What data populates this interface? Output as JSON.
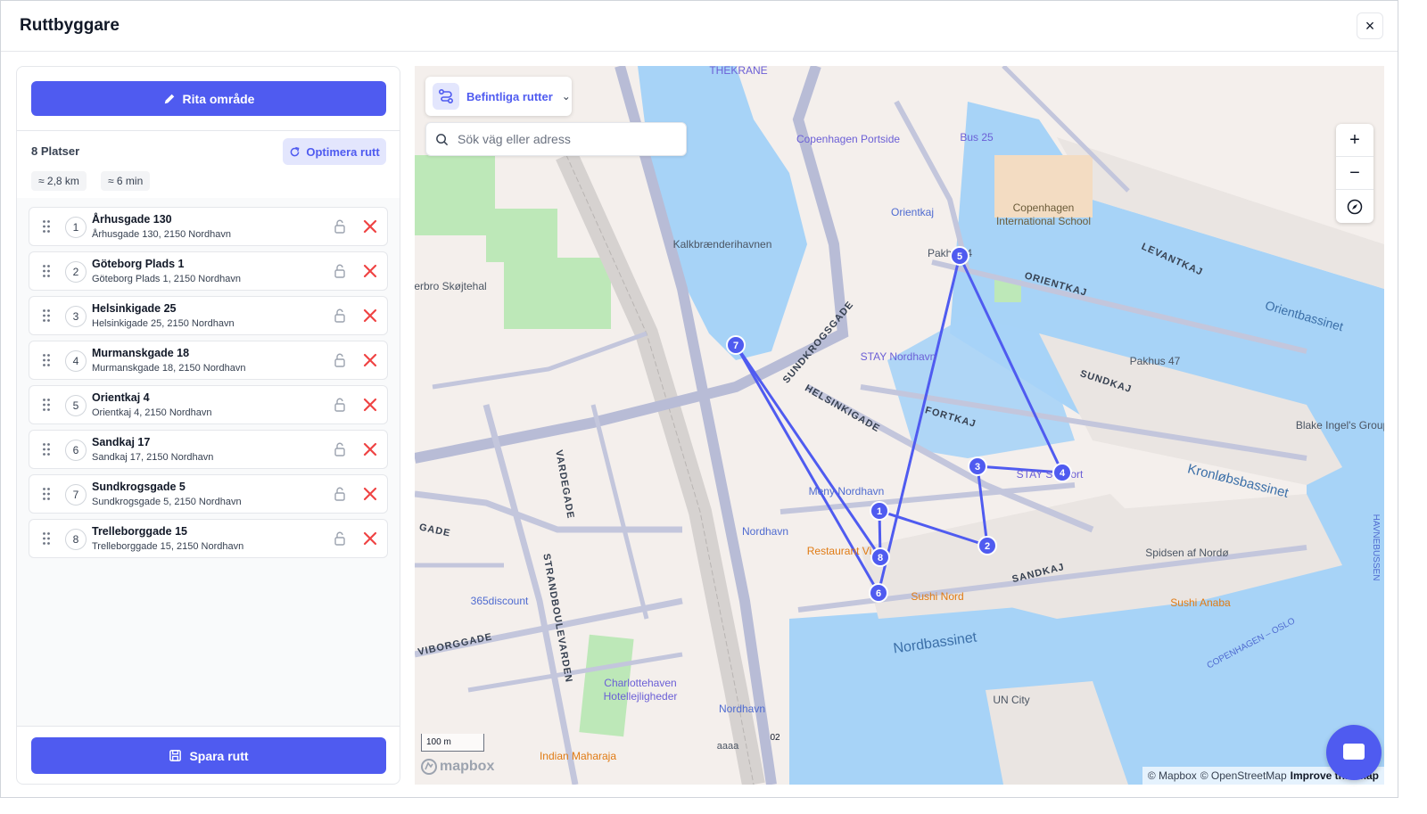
{
  "header": {
    "title": "Ruttbyggare",
    "close_label": "×"
  },
  "panel": {
    "draw_label": "Rita område",
    "places_count": "8 Platser",
    "optimize_label": "Optimera rutt",
    "distance": "≈ 2,8 km",
    "duration": "≈ 6 min",
    "save_label": "Spara rutt",
    "stops": [
      {
        "n": "1",
        "name": "Århusgade 130",
        "addr": "Århusgade 130, 2150 Nordhavn"
      },
      {
        "n": "2",
        "name": "Göteborg Plads 1",
        "addr": "Göteborg Plads 1, 2150 Nordhavn"
      },
      {
        "n": "3",
        "name": "Helsinkigade 25",
        "addr": "Helsinkigade 25, 2150 Nordhavn"
      },
      {
        "n": "4",
        "name": "Murmanskgade 18",
        "addr": "Murmanskgade 18, 2150 Nordhavn"
      },
      {
        "n": "5",
        "name": "Orientkaj 4",
        "addr": "Orientkaj 4, 2150 Nordhavn"
      },
      {
        "n": "6",
        "name": "Sandkaj 17",
        "addr": "Sandkaj 17, 2150 Nordhavn"
      },
      {
        "n": "7",
        "name": "Sundkrogsgade 5",
        "addr": "Sundkrogsgade 5, 2150 Nordhavn"
      },
      {
        "n": "8",
        "name": "Trelleborggade 15",
        "addr": "Trelleborggade 15, 2150 Nordhavn"
      }
    ]
  },
  "map": {
    "routes_label": "Befintliga rutter",
    "search_placeholder": "Sök väg eller adress",
    "zoom_in": "+",
    "zoom_out": "−",
    "scale_label": "100 m",
    "logo_text": "mapbox",
    "attribution": {
      "mapbox": "© Mapbox",
      "osm": "© OpenStreetMap",
      "improve": "Improve this map"
    },
    "route_color": "#4f5bf0",
    "water_color": "#a7d3f7",
    "park_color": "#bde8b8",
    "labels": [
      {
        "text": "THEKRANE",
        "kind": "poi"
      },
      {
        "text": "Copenhagen Portside",
        "kind": "poi"
      },
      {
        "text": "Bus 25",
        "kind": "poi"
      },
      {
        "text": "Copenhagen",
        "kind": "school"
      },
      {
        "text": "International School",
        "kind": "school"
      },
      {
        "text": "Orientkaj",
        "kind": "transit"
      },
      {
        "text": "Kalkbrænderihavnen",
        "kind": "place"
      },
      {
        "text": "Pakhus 4",
        "kind": "place"
      },
      {
        "text": "LEVANTKAJ",
        "kind": "street"
      },
      {
        "text": "ORIENTKAJ",
        "kind": "street"
      },
      {
        "text": "Orientbassinet",
        "kind": "water"
      },
      {
        "text": "erbro Skøjtehal",
        "kind": "poi"
      },
      {
        "text": "SUNDKROGSGADE",
        "kind": "street"
      },
      {
        "text": "STAY Nordhavn",
        "kind": "poi"
      },
      {
        "text": "Pakhus 47",
        "kind": "place"
      },
      {
        "text": "SUNDKAJ",
        "kind": "street"
      },
      {
        "text": "HELSINKIGADE",
        "kind": "street"
      },
      {
        "text": "FORTKAJ",
        "kind": "street"
      },
      {
        "text": "Blake Ingel's Group",
        "kind": "place"
      },
      {
        "text": "VARDEGADE",
        "kind": "street"
      },
      {
        "text": "Meny Nordhavn",
        "kind": "poi"
      },
      {
        "text": "STAY Seaport",
        "kind": "poi"
      },
      {
        "text": "Kronløbsbassinet",
        "kind": "water"
      },
      {
        "text": "GADE",
        "kind": "street"
      },
      {
        "text": "Nordhavn",
        "kind": "transit"
      },
      {
        "text": "Restaurant Vi",
        "kind": "food"
      },
      {
        "text": "SANDKAJ",
        "kind": "street"
      },
      {
        "text": "Spidsen af Nordø",
        "kind": "place"
      },
      {
        "text": "HAVNEBUSSEN",
        "kind": "water-route"
      },
      {
        "text": "STRANDBOULEVARDEN",
        "kind": "street"
      },
      {
        "text": "365discount",
        "kind": "poi"
      },
      {
        "text": "Sushi Nord",
        "kind": "food"
      },
      {
        "text": "Sushi Anaba",
        "kind": "food"
      },
      {
        "text": "COPENHAGEN – OSLO",
        "kind": "water-route"
      },
      {
        "text": "VIBORGGADE",
        "kind": "street"
      },
      {
        "text": "Nordbassinet",
        "kind": "water"
      },
      {
        "text": "Charlottehaven",
        "kind": "poi"
      },
      {
        "text": "Hotellejligheder",
        "kind": "poi"
      },
      {
        "text": "UN City",
        "kind": "place"
      },
      {
        "text": "Nordhavn",
        "kind": "transit"
      },
      {
        "text": "aaaa",
        "kind": "place"
      },
      {
        "text": "02",
        "kind": "shield"
      },
      {
        "text": "Indian Maharaja",
        "kind": "food"
      }
    ],
    "markers": [
      "1",
      "2",
      "3",
      "4",
      "5",
      "6",
      "7",
      "8"
    ]
  }
}
